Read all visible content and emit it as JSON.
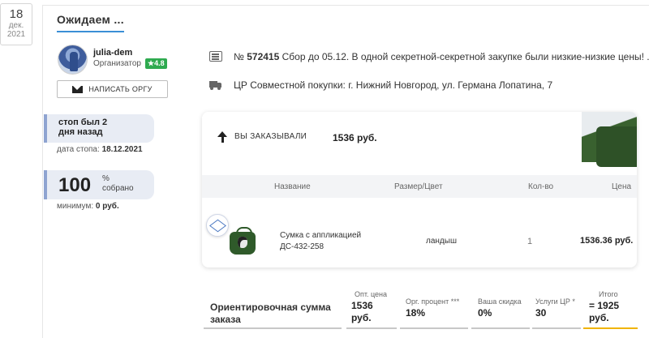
{
  "date": {
    "day": "18",
    "month": "дек.",
    "year": "2021"
  },
  "status": {
    "title": "Ожидаем ..."
  },
  "organizer": {
    "name": "julia-dem",
    "role": "Организатор",
    "rating": "★4.8",
    "write_button": "НАПИСАТЬ ОРГУ"
  },
  "stop": {
    "line1": "стоп был 2",
    "line2": "дня назад",
    "date_label": "дата стопа:",
    "date_value": "18.12.2021"
  },
  "collected": {
    "value": "100",
    "percent_sign": "%",
    "label": "собрано",
    "minimum_label": "минимум:",
    "minimum_value": "0 руб."
  },
  "purchase": {
    "number_prefix": "№",
    "number": "572415",
    "title": "Сбор до 05.12. В одной секретной-секретной закупке были низкие-низкие цены! ...",
    "address": "ЦР Совместной покупки: г. Нижний Новгород, ул. Германа Лопатина, 7"
  },
  "order": {
    "ordered_label": "ВЫ ЗАКАЗЫВАЛИ",
    "ordered_sum": "1536 руб.",
    "columns": {
      "name": "Название",
      "size": "Размер/Цвет",
      "qty": "Кол-во",
      "price": "Цена"
    },
    "item": {
      "name_line1": "Сумка с аппликацией",
      "name_line2": "ДС-432-258",
      "size": "ландыш",
      "qty": "1",
      "price": "1536.36 руб."
    }
  },
  "summary": {
    "title_line1": "Ориентировочная сумма",
    "title_line2": "заказа",
    "opt_price_label": "Опт. цена",
    "opt_price_line1": "1536",
    "opt_price_line2": "руб.",
    "org_percent_label": "Орг. процент ***",
    "org_percent": "18%",
    "discount_label": "Ваша скидка",
    "discount": "0%",
    "services_label": "Услуги ЦР *",
    "services": "30",
    "total_label": "Итого",
    "total_line1": "= 1925",
    "total_line2": "руб."
  },
  "colors": {
    "accent_blue": "#3b8fd6",
    "rating_green": "#2eaa4f",
    "total_gold": "#f0b400",
    "info_box_bg": "#e8ecf4"
  }
}
